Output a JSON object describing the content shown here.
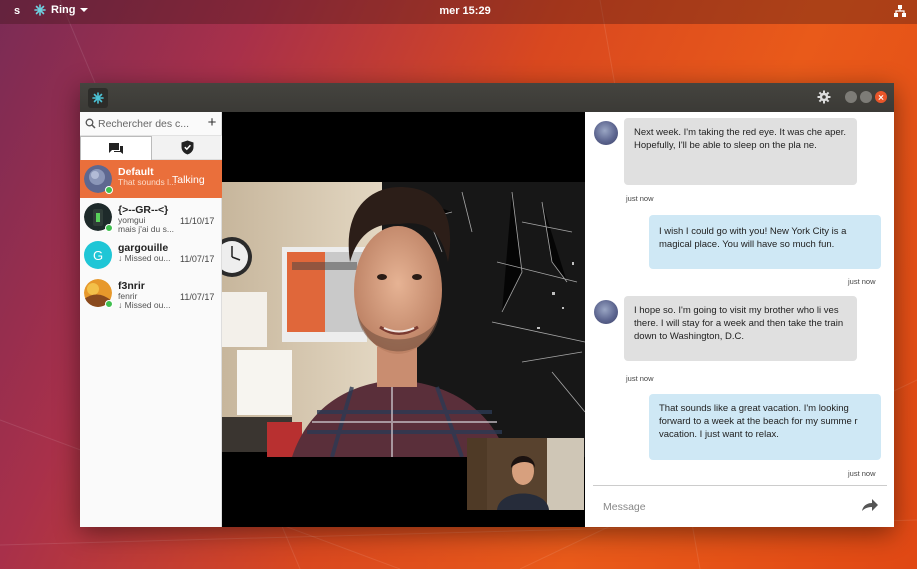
{
  "topbar": {
    "activities_fragment": "s",
    "app_name": "Ring",
    "clock": "mer 15:29"
  },
  "sidebar": {
    "search_placeholder": "Rechercher des c...",
    "add_label": "+",
    "tabs": [
      {
        "icon": "conversations-icon"
      },
      {
        "icon": "shield-check-icon"
      }
    ],
    "contacts": [
      {
        "name": "Default",
        "subtitle": "That sounds l...",
        "status": "Talking",
        "date": "",
        "online": true,
        "active": true
      },
      {
        "name": "{>--GR--<}",
        "subtitle": "yomgui",
        "subtitle2": "mais j'ai du s...",
        "date": "11/10/17",
        "online": true
      },
      {
        "name": "gargouille",
        "subtitle": "↓ Missed ou...",
        "date": "11/07/17",
        "avatar_letter": "G",
        "avatar_color": "#1fc6d6",
        "online": false
      },
      {
        "name": "f3nrir",
        "subtitle": "fenrir",
        "subtitle2": "↓ Missed ou...",
        "date": "11/07/17",
        "online": true
      }
    ]
  },
  "chat": {
    "messages": [
      {
        "direction": "in",
        "text": "Next week. I'm taking the red  eye. It was che aper. Hopefully, I'll be able to sleep on the pla ne.",
        "time": "just now"
      },
      {
        "direction": "out",
        "text": "I wish I could go with you! New York City is a magical place. You will have so much fun.",
        "time": "just now"
      },
      {
        "direction": "in",
        "text": " I hope so. I'm going to visit my brother who li ves there. I will stay for a week and then take the train down to Washington, D.C.",
        "time": "just now"
      },
      {
        "direction": "out",
        "text": "That sounds like a great vacation. I'm looking forward to a week at the beach for my summe r vacation. I just want to relax.",
        "time": "just now"
      }
    ],
    "composer_placeholder": "Message"
  },
  "colors": {
    "accent": "#ea6f3b",
    "outgoing_bubble": "#cfe8f5",
    "incoming_bubble": "#e0e0e0",
    "online": "#3fbf4f"
  }
}
